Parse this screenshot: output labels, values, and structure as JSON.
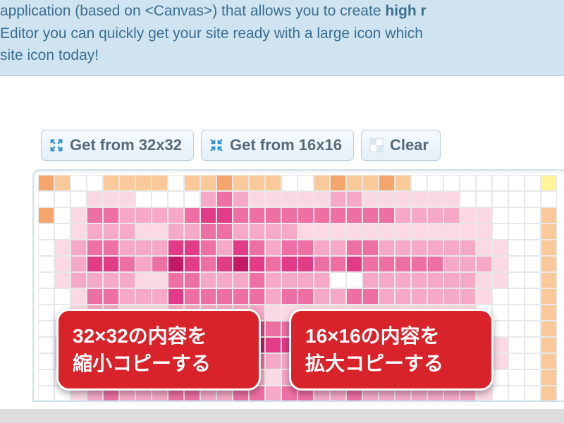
{
  "banner": {
    "line1_pre": "application (based on <Canvas>) that allows you to create ",
    "line1_bold": "high r",
    "line2": "Editor you can quickly get your site ready with a large icon which ",
    "line3": "site icon today!"
  },
  "toolbar": {
    "btn32": "Get from 32x32",
    "btn16": "Get from 16x16",
    "clear": "Clear"
  },
  "callouts": {
    "c1_line1": "32×32の内容を",
    "c1_line2": "縮小コピーする",
    "c2_line1": "16×16の内容を",
    "c2_line2": "拡大コピーする"
  },
  "icons": {
    "expand": "expand-icon",
    "contract": "contract-icon",
    "checker": "checker-icon"
  },
  "palette": {
    "w": "#ffffff",
    "y": "#fff59a",
    "o1": "#f9c99a",
    "o2": "#f3a56c",
    "p1": "#fbd9e4",
    "p2": "#f6a9c6",
    "p3": "#ee6fa3",
    "p4": "#e23b87",
    "p5": "#c41968"
  },
  "grid_rows": [
    "o2,o1,w,w,o1,o1,o1,o1,w,o1,o1,o2,o1,o1,o1,w,w,o1,o2,o1,o1,o2,o1,w,w,w,w,w,w,w,w,y",
    "w,w,w,p1,p1,p1,w,w,w,w,p2,p3,p2,p1,p1,p1,p1,p1,p2,p2,p1,p1,p1,p1,p1,p1,w,w,w,w,w,w",
    "o2,w,p1,p3,p3,p2,p2,p2,p2,p3,p4,p4,p3,p3,p3,p3,p3,p3,p3,p3,p3,p3,p2,p2,p2,p2,p1,p1,w,w,w,o1",
    "w,w,p1,p2,p2,p2,p1,p1,p2,p2,p3,p3,p2,p2,p2,p2,p1,p1,p1,p1,p1,p1,p1,p1,p1,p1,p1,p1,w,w,w,o1",
    "w,p1,p2,p3,p3,p2,p2,p2,p4,p4,p3,p2,p4,p3,p2,p3,p3,p2,p2,p3,p3,p2,p2,p2,p2,p2,p2,p1,p1,w,w,o1",
    "w,p1,p2,p4,p4,p3,p2,p3,p5,p4,p3,p4,p5,p4,p3,p4,p4,p3,p3,p4,p3,p3,p3,p3,p3,p2,p2,p2,p1,w,w,o1",
    "w,p1,p2,p2,p2,p2,p1,p1,p3,p3,p2,p2,p2,p3,p2,p2,p2,p2,w,w,p2,p2,p2,p2,p2,p2,p2,p1,p1,w,w,o1",
    "w,w,p1,p3,p3,p2,p2,p2,p4,p3,p3,p3,p3,p3,p2,p3,p3,p2,p2,p3,p3,p2,p2,p2,p2,p2,p2,p1,w,w,w,o1",
    "w,w,p1,p2,p2,p1,p1,p1,p2,p2,p2,p2,p2,p2,p1,p1,p1,p1,p1,p1,p1,p1,p1,p1,p1,p1,p1,w,w,w,w,o1",
    "w,w,p1,p3,p4,p3,p2,p3,p4,p4,p3,p3,p4,p4,p3,p3,p3,p3,p3,p4,p3,p3,p3,p3,p3,p2,p2,p1,w,w,w,o1",
    "w,p1,p2,p4,p5,p4,p3,p3,p5,p5,p4,p4,p5,p5,p4,p4,p4,p4,p4,p5,p4,p4,p4,p4,p3,p3,p3,p2,p1,w,w,o1",
    "w,p1,p2,p3,p3,p2,p2,p2,p3,p3,p3,p3,p3,p3,p2,p2,p2,p2,p2,p3,p2,p2,p2,p2,p2,p2,p2,p1,p1,w,w,o1",
    "w,w,p1,p2,p2,p1,p1,p1,p2,p2,p2,p2,p2,p2,p1,p2,p2,p1,p1,p2,p2,p1,p1,p1,p1,p1,p1,p1,w,w,w,o1",
    "w,w,p1,p2,p3,p2,p2,p2,p3,p3,p2,p2,p3,p3,p2,p3,p3,p2,p2,p3,p2,p2,p2,p2,p2,p2,p2,p1,w,w,w,o1"
  ]
}
